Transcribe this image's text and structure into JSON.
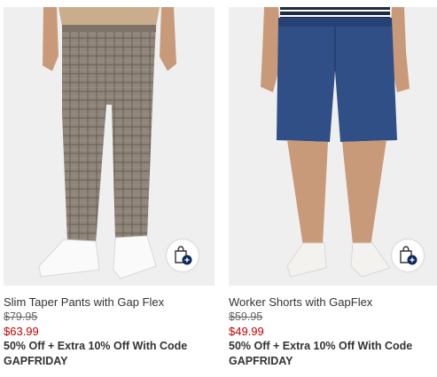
{
  "products": [
    {
      "title": "Slim Taper Pants with Gap Flex",
      "original_price": "$79.95",
      "sale_price": "$63.99",
      "promo_line1": "50% Off + Extra 10% Off With Code",
      "promo_line2": "GAPFRIDAY",
      "bag_icon": "shopping-bag-add-icon"
    },
    {
      "title": "Worker Shorts with GapFlex",
      "original_price": "$59.95",
      "sale_price": "$49.99",
      "promo_line1": "50% Off + Extra 10% Off With Code",
      "promo_line2": "GAPFRIDAY",
      "bag_icon": "shopping-bag-add-icon"
    }
  ],
  "colors": {
    "sale_price": "#c00000",
    "image_background": "#f0f0f0",
    "bag_badge": "#0b2a5b"
  }
}
